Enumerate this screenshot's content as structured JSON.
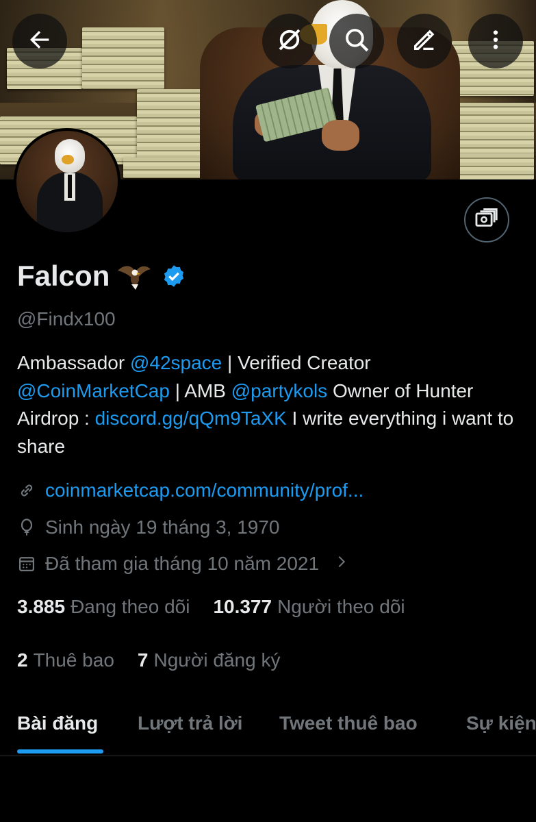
{
  "profile": {
    "name": "Falcon",
    "handle": "@Findx100",
    "bio": {
      "p1": "Ambassador ",
      "m1": "@42space",
      "p2": " | Verified Creator ",
      "m2": "@CoinMarketCap",
      "p3": " | AMB ",
      "m3": "@partykols",
      "p4": "  Owner of Hunter Airdrop : ",
      "m4": "discord.gg/qQm9TaXK",
      "p5": " I write everything i want to share"
    },
    "website": "coinmarketcap.com/community/prof...",
    "birthday": "Sinh ngày 19 tháng 3, 1970",
    "joined": "Đã tham gia tháng 10 năm 2021",
    "following_count": "3.885",
    "following_label": "Đang theo dõi",
    "followers_count": "10.377",
    "followers_label": "Người theo dõi",
    "subscriptions_count": "2",
    "subscriptions_label": "Thuê bao",
    "subscribers_count": "7",
    "subscribers_label": "Người đăng ký"
  },
  "tabs": [
    {
      "label": "Bài đăng",
      "active": true
    },
    {
      "label": "Lượt trả lời",
      "active": false
    },
    {
      "label": "Tweet thuê bao",
      "active": false
    },
    {
      "label": "Sự kiện",
      "active": false
    }
  ],
  "icons": {
    "back": "arrow-left-icon",
    "grok": "grok-icon",
    "search": "search-icon",
    "edit": "edit-icon",
    "more": "more-vertical-icon",
    "money": "money-icon",
    "verified": "verified-badge-icon",
    "link": "link-icon",
    "birthday": "balloon-icon",
    "calendar": "calendar-icon",
    "chevron": "chevron-right-icon"
  },
  "colors": {
    "accent": "#1d9bf0",
    "background": "#000000",
    "text": "#e7e9ea",
    "muted": "#71767b"
  }
}
